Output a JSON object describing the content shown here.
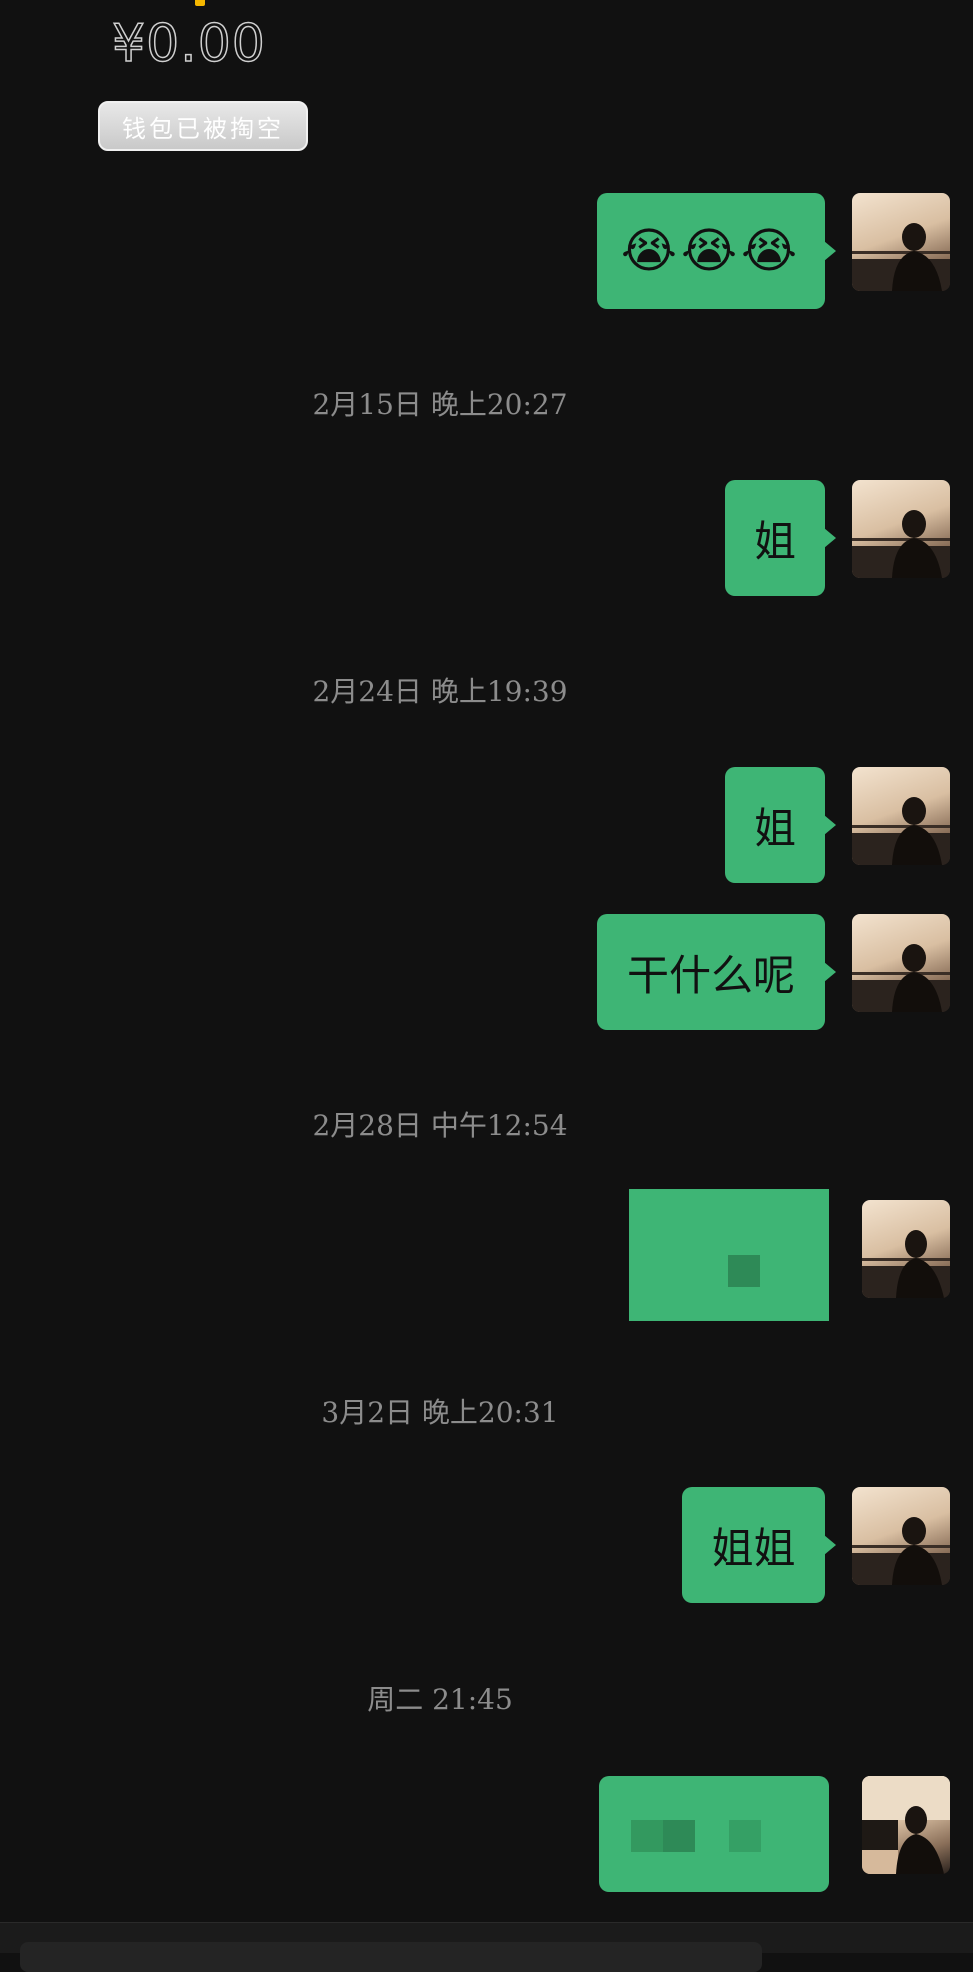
{
  "wallet": {
    "amount": "¥0.00",
    "status": "钱包已被掏空"
  },
  "messages": [
    {
      "type": "text",
      "text": "😭😭😭"
    },
    {
      "type": "timestamp",
      "text": "2月15日 晚上20:27"
    },
    {
      "type": "text",
      "text": "姐"
    },
    {
      "type": "timestamp",
      "text": "2月24日 晚上19:39"
    },
    {
      "type": "text",
      "text": "姐"
    },
    {
      "type": "text",
      "text": "干什么呢"
    },
    {
      "type": "timestamp",
      "text": "2月28日 中午12:54"
    },
    {
      "type": "media"
    },
    {
      "type": "timestamp",
      "text": "3月2日 晚上20:31"
    },
    {
      "type": "text",
      "text": "姐姐"
    },
    {
      "type": "timestamp",
      "text": "周二 21:45"
    },
    {
      "type": "media"
    }
  ],
  "colors": {
    "background": "#111111",
    "bubble_outgoing": "#3eb575",
    "timestamp_text": "#8c8c8c",
    "wallet_accent": "#f5b700"
  },
  "icons": {
    "avatar": "profile-photo-silhouette"
  }
}
